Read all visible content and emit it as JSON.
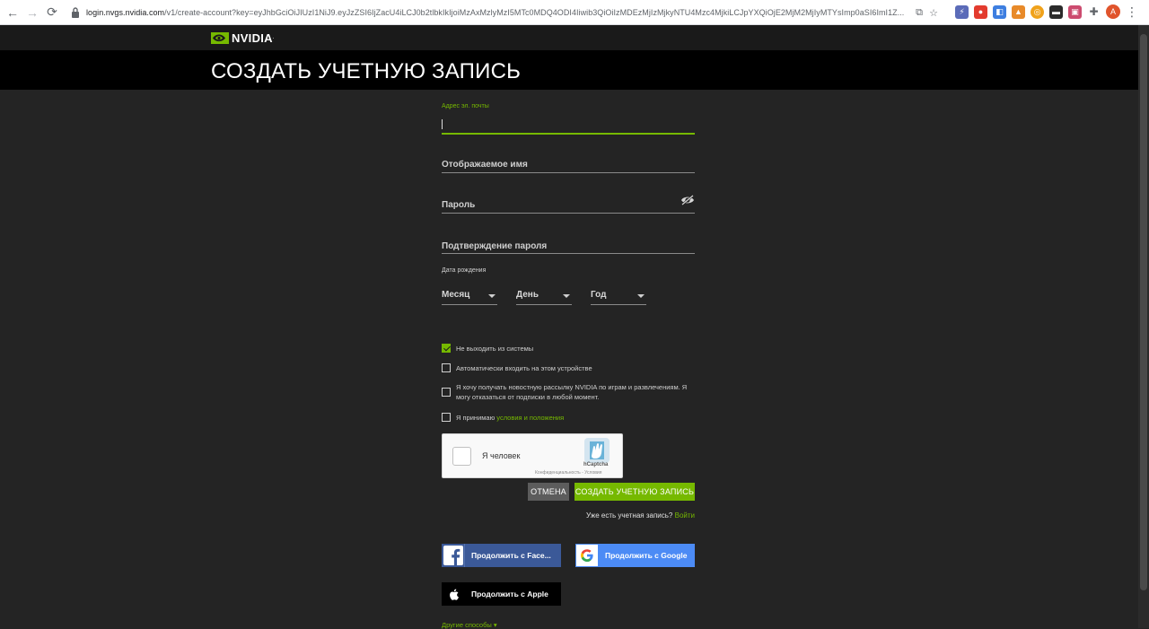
{
  "browser": {
    "url_host": "login.nvgs.nvidia.com",
    "url_rest": "/v1/create-account?key=eyJhbGciOiJIUzI1NiJ9.eyJzZSI6IjZacU4iLCJ0b2tlbkIkIjoiMzAxMzlyMzI5MTc0MDQ4ODI4Iiwib3QiOiIzMDEzMjIzMjkyNTU4Mzc4MjkiLCJpYXQiOjE2MjM2MjIyMTYsImp0aSI6ImI1Z...",
    "avatar_letter": "A"
  },
  "brand": {
    "logo_text": "NVIDIA",
    "trademark": "."
  },
  "page_title": "СОЗДАТЬ УЧЕТНУЮ ЗАПИСЬ",
  "form": {
    "email_label": "Адрес эл. почты",
    "email_value": "",
    "display_name_label": "Отображаемое имя",
    "password_label": "Пароль",
    "confirm_password_label": "Подтверждение пароля",
    "dob_label": "Дата рождения",
    "month_label": "Месяц",
    "day_label": "День",
    "year_label": "Год",
    "checks": {
      "stay_signed_in": "Не выходить из системы",
      "stay_signed_in_checked": true,
      "auto_login": "Автоматически входить на этом устройстве",
      "auto_login_checked": false,
      "newsletter": "Я хочу получать новостную рассылку NVIDIA по играм и развлечениям. Я могу отказаться от подписки в любой момент.",
      "newsletter_checked": false,
      "terms_prefix": "Я принимаю ",
      "terms_link": "условия и положения",
      "terms_checked": false
    },
    "captcha": {
      "text": "Я человек",
      "brand": "hCaptcha",
      "links": "Конфиденциальность - Условия"
    },
    "cancel_label": "ОТМЕНА",
    "create_label": "СОЗДАТЬ УЧЕТНУЮ ЗАПИСЬ",
    "have_account_text": "Уже есть учетная запись?",
    "login_link": "Войти"
  },
  "social": {
    "facebook_label": "Продолжить с Face...",
    "google_label": "Продолжить с Google",
    "apple_label": "Продолжить с Apple"
  },
  "other_methods_label": "Другие способы ▾",
  "colors": {
    "accent": "#76b900",
    "background": "#242424",
    "facebook": "#3b5998",
    "google": "#4c8bf5"
  }
}
